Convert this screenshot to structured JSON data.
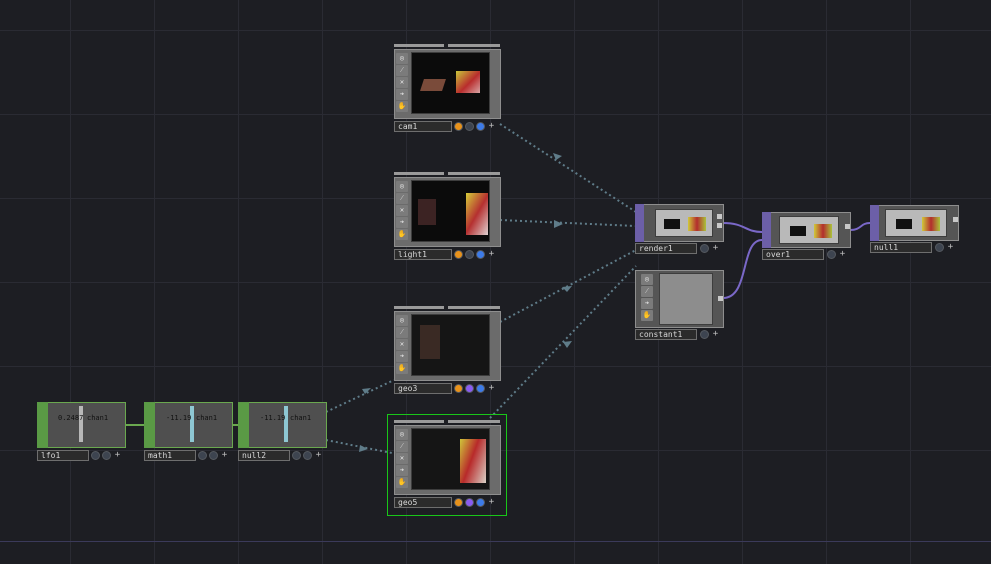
{
  "nodes": {
    "cam1": {
      "label": "cam1",
      "dot_colors": [
        "#e8921b",
        "#3a4b66",
        "#3d7be8"
      ]
    },
    "light1": {
      "label": "light1",
      "dot_colors": [
        "#e8921b",
        "#3a4b66",
        "#3d7be8"
      ]
    },
    "geo3": {
      "label": "geo3",
      "dot_colors": [
        "#e8921b",
        "#8a5cf0",
        "#3d7be8"
      ]
    },
    "geo5": {
      "label": "geo5",
      "dot_colors": [
        "#e8921b",
        "#8a5cf0",
        "#3d7be8"
      ]
    },
    "render1": {
      "label": "render1"
    },
    "constant1": {
      "label": "constant1"
    },
    "over1": {
      "label": "over1"
    },
    "null1": {
      "label": "null1"
    },
    "lfo1": {
      "label": "lfo1",
      "value": "0.2487",
      "channel": "chan1"
    },
    "math1": {
      "label": "math1",
      "value": "-11.19",
      "channel": "chan1"
    },
    "null2": {
      "label": "null2",
      "value": "-11.19",
      "channel": "chan1"
    }
  },
  "colors": {
    "background": "#1d1e23",
    "wire_dotted": "#5f7c89",
    "wire_top": "#7a68c8",
    "wire_chop": "#6aa84f",
    "selected": "#19c619"
  },
  "icons": [
    "target-icon",
    "wand-icon",
    "x-icon",
    "arrow-right-icon",
    "hand-icon",
    "plus-icon"
  ]
}
